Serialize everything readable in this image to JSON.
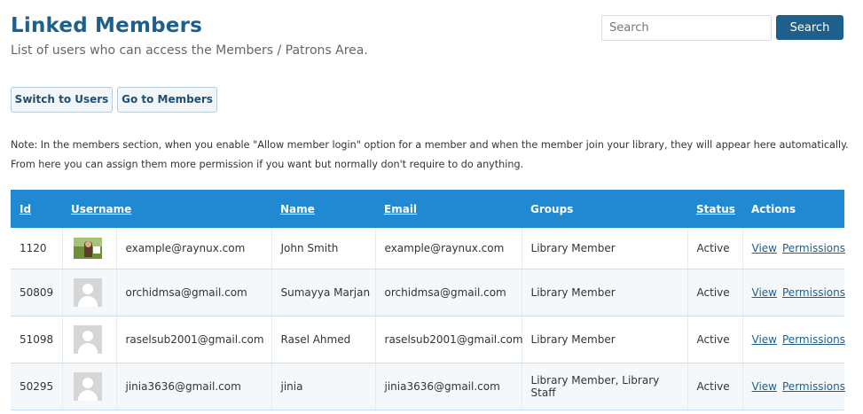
{
  "header": {
    "title": "Linked Members",
    "subtitle": "List of users who can access the Members / Patrons Area."
  },
  "search": {
    "placeholder": "Search",
    "button_label": "Search"
  },
  "buttons": {
    "switch_to_users": "Switch to Users",
    "go_to_members": "Go to Members"
  },
  "note": "Note: In the members section, when you enable \"Allow member login\" option for a member and when the member join your library, they will appear here automatically. From here you can assign them more permission if you want but normally don't require to do anything.",
  "table": {
    "headers": {
      "id": "Id",
      "username": "Username",
      "name": "Name",
      "email": "Email",
      "groups": "Groups",
      "status": "Status",
      "actions": "Actions"
    },
    "action_labels": {
      "view": "View",
      "permissions": "Permissions"
    },
    "rows": [
      {
        "id": "1120",
        "avatar": "photo-avatar",
        "username": "example@raynux.com",
        "name": "John Smith",
        "email": "example@raynux.com",
        "groups": "Library Member",
        "status": "Active"
      },
      {
        "id": "50809",
        "avatar": "default-avatar",
        "username": "orchidmsa@gmail.com",
        "name": "Sumayya Marjan",
        "email": "orchidmsa@gmail.com",
        "groups": "Library Member",
        "status": "Active"
      },
      {
        "id": "51098",
        "avatar": "default-avatar",
        "username": "raselsub2001@gmail.com",
        "name": "Rasel Ahmed",
        "email": "raselsub2001@gmail.com",
        "groups": "Library Member",
        "status": "Active"
      },
      {
        "id": "50295",
        "avatar": "default-avatar",
        "username": "jinia3636@gmail.com",
        "name": "jinia",
        "email": "jinia3636@gmail.com",
        "groups": "Library Member, Library Staff",
        "status": "Active"
      }
    ]
  },
  "colors": {
    "title": "#1f5f8b",
    "table_header": "#2089d2",
    "search_button": "#1f5f8b",
    "link": "#1f5f8b"
  }
}
